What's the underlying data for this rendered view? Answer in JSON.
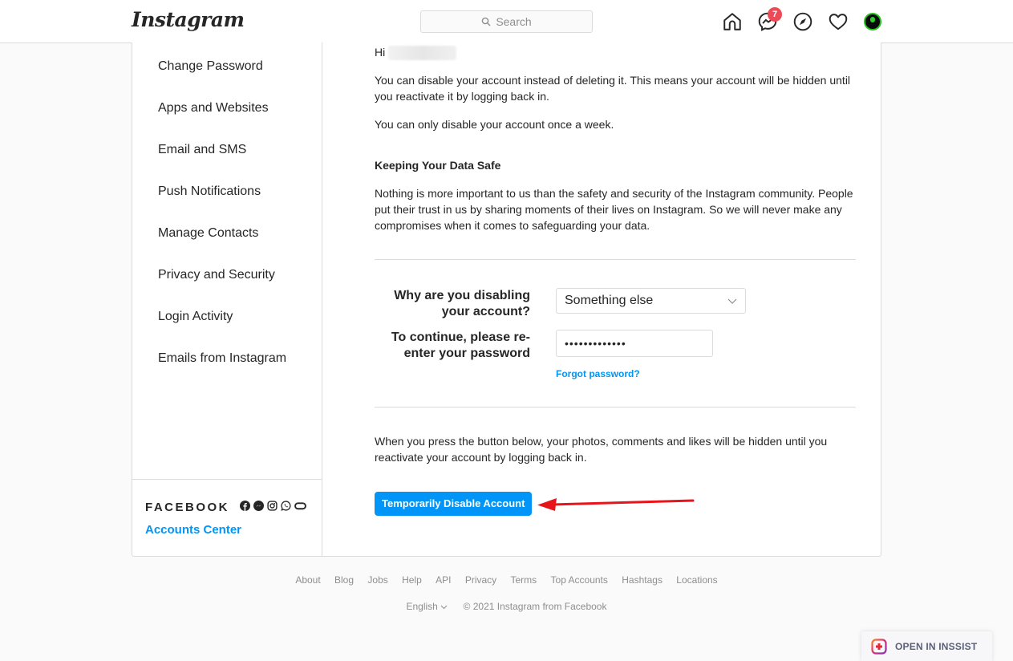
{
  "header": {
    "logo": "Instagram",
    "search_placeholder": "Search",
    "icons": [
      "home-icon",
      "messenger-icon",
      "explore-icon",
      "activity-heart-icon",
      "profile-avatar"
    ],
    "messenger_badge": "7"
  },
  "sidebar": {
    "items": [
      {
        "label": "Change Password"
      },
      {
        "label": "Apps and Websites"
      },
      {
        "label": "Email and SMS"
      },
      {
        "label": "Push Notifications"
      },
      {
        "label": "Manage Contacts"
      },
      {
        "label": "Privacy and Security"
      },
      {
        "label": "Login Activity"
      },
      {
        "label": "Emails from Instagram"
      }
    ],
    "footer": {
      "brand": "FACEBOOK",
      "brand_icons": [
        "facebook-icon",
        "messenger-icon",
        "instagram-icon",
        "whatsapp-icon",
        "oculus-icon"
      ],
      "accounts_center": "Accounts Center"
    }
  },
  "main": {
    "greeting": "Hi",
    "intro": "You can disable your account instead of deleting it. This means your account will be hidden until you reactivate it by logging back in.",
    "once_a_week": "You can only disable your account once a week.",
    "data_safe_heading": "Keeping Your Data Safe",
    "data_safe_text": "Nothing is more important to us than the safety and security of the Instagram community. People put their trust in us by sharing moments of their lives on Instagram. So we will never make any compromises when it comes to safeguarding your data.",
    "reason_label": "Why are you disabling your account?",
    "reason_value": "Something else",
    "password_label": "To continue, please re-enter your password",
    "password_value": "•••••••••••••",
    "forgot_password": "Forgot password?",
    "warning": "When you press the button below, your photos, comments and likes will be hidden until you reactivate your account by logging back in.",
    "disable_button": "Temporarily Disable Account"
  },
  "footer": {
    "links": [
      "About",
      "Blog",
      "Jobs",
      "Help",
      "API",
      "Privacy",
      "Terms",
      "Top Accounts",
      "Hashtags",
      "Locations"
    ],
    "language": "English",
    "copyright": "© 2021 Instagram from Facebook"
  },
  "inssist": {
    "label": "OPEN IN INSSIST"
  },
  "colors": {
    "accent": "#0095f6",
    "badge": "#ed4956",
    "annotation_arrow": "#e8141c"
  }
}
